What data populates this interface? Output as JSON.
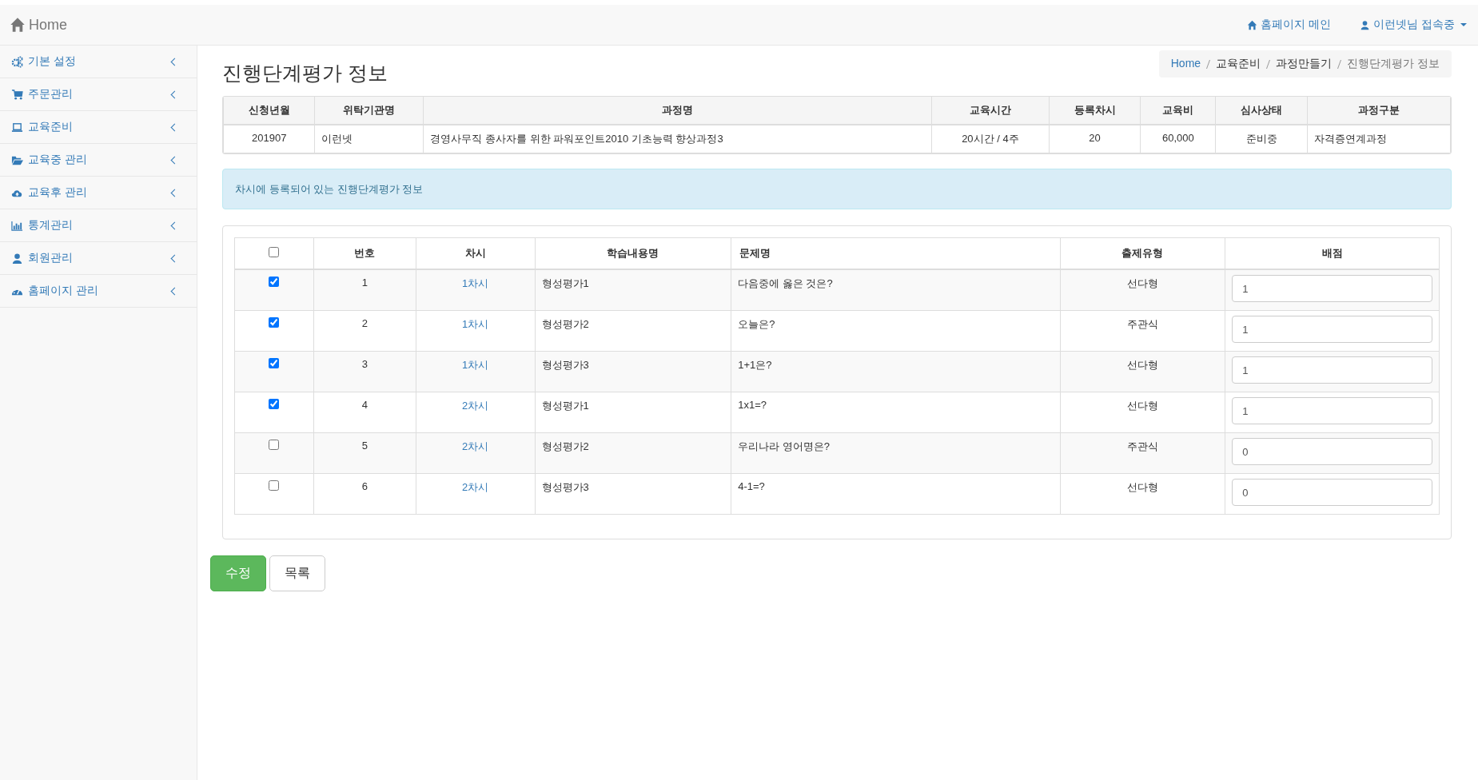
{
  "navbar": {
    "brand": "Home",
    "links": [
      {
        "kind": "home",
        "label": "홈페이지 메인",
        "dropdown": false
      },
      {
        "kind": "user",
        "label": "이런넷님 접속중",
        "dropdown": true
      }
    ]
  },
  "sidebar": {
    "items": [
      {
        "kind": "gears",
        "label": "기본 설정"
      },
      {
        "kind": "cart",
        "label": "주문관리"
      },
      {
        "kind": "laptop",
        "label": "교육준비"
      },
      {
        "kind": "folder",
        "label": "교육중 관리"
      },
      {
        "kind": "cloud",
        "label": "교육후 관리"
      },
      {
        "kind": "chart",
        "label": "통계관리"
      },
      {
        "kind": "user",
        "label": "회원관리"
      },
      {
        "kind": "dashboard",
        "label": "홈페이지 관리"
      }
    ]
  },
  "page_title": "진행단계평가 정보",
  "breadcrumb": [
    {
      "kind": "link",
      "label": "Home"
    },
    {
      "kind": "item",
      "label": "교육준비"
    },
    {
      "kind": "item",
      "label": "과정만들기"
    },
    {
      "kind": "current",
      "label": "진행단계평가 정보"
    }
  ],
  "course_table": {
    "columns": [
      "신청년월",
      "위탁기관명",
      "과정명",
      "교육시간",
      "등록차시",
      "교육비",
      "심사상태",
      "과정구분"
    ],
    "rows": [
      [
        "201907",
        "이런넷",
        "경영사무직 종사자를 위한 파워포인트2010 기초능력 향상과정3",
        "20시간 / 4주",
        "20",
        "60,000",
        "준비중",
        "자격증연계과정"
      ]
    ]
  },
  "notice": "차시에 등록되어 있는 진행단계평가 정보",
  "question_table": {
    "select_all": {
      "checked": false
    },
    "columns": [
      "번호",
      "차시",
      "학습내용명",
      "문제명",
      "출제유형",
      "배점"
    ],
    "rows": [
      {
        "checked": true,
        "number": "1",
        "session": "1차시",
        "content": "형성평가1",
        "question": "다음중에 옳은 것은?",
        "type": "선다형",
        "score": "1"
      },
      {
        "checked": true,
        "number": "2",
        "session": "1차시",
        "content": "형성평가2",
        "question": "오늘은?",
        "type": "주관식",
        "score": "1"
      },
      {
        "checked": true,
        "number": "3",
        "session": "1차시",
        "content": "형성평가3",
        "question": "1+1은?",
        "type": "선다형",
        "score": "1"
      },
      {
        "checked": true,
        "number": "4",
        "session": "2차시",
        "content": "형성평가1",
        "question": "1x1=?",
        "type": "선다형",
        "score": "1"
      },
      {
        "checked": false,
        "number": "5",
        "session": "2차시",
        "content": "형성평가2",
        "question": "우리나라 영어명은?",
        "type": "주관식",
        "score": "0"
      },
      {
        "checked": false,
        "number": "6",
        "session": "2차시",
        "content": "형성평가3",
        "question": "4-1=?",
        "type": "선다형",
        "score": "0"
      }
    ]
  },
  "buttons": [
    {
      "kind": "primary",
      "label": "수정"
    },
    {
      "kind": "default",
      "label": "목록"
    }
  ]
}
